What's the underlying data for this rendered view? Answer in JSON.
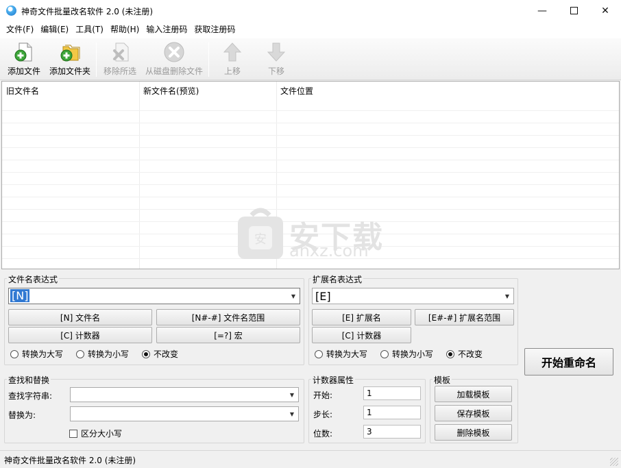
{
  "window": {
    "title": "神奇文件批量改名软件 2.0 (未注册)"
  },
  "menu": [
    "文件(F)",
    "编辑(E)",
    "工具(T)",
    "帮助(H)",
    "输入注册码",
    "获取注册码"
  ],
  "toolbar": {
    "add_file": "添加文件",
    "add_folder": "添加文件夹",
    "remove_selected": "移除所选",
    "delete_from_disk": "从磁盘删除文件",
    "move_up": "上移",
    "move_down": "下移"
  },
  "file_list": {
    "columns": [
      "旧文件名",
      "新文件名(预览)",
      "文件位置"
    ],
    "rows": []
  },
  "watermark": {
    "text": "安下载",
    "sub": "anxz.com"
  },
  "filename_expr": {
    "label": "文件名表达式",
    "value": "[N]",
    "buttons": [
      "[N] 文件名",
      "[N#-#] 文件名范围",
      "[C] 计数器",
      "[=?] 宏"
    ],
    "radios": [
      "转换为大写",
      "转换为小写",
      "不改变"
    ],
    "selected_radio": 2
  },
  "ext_expr": {
    "label": "扩展名表达式",
    "value": "[E]",
    "buttons": [
      "[E] 扩展名",
      "[E#-#] 扩展名范围",
      "[C] 计数器"
    ],
    "radios": [
      "转换为大写",
      "转换为小写",
      "不改变"
    ],
    "selected_radio": 2
  },
  "find_replace": {
    "label": "查找和替换",
    "find_label": "查找字符串:",
    "find_value": "",
    "replace_label": "替换为:",
    "replace_value": "",
    "case_label": "区分大小写",
    "case_checked": false
  },
  "counter": {
    "label": "计数器属性",
    "start_label": "开始:",
    "start_value": "1",
    "step_label": "步长:",
    "step_value": "1",
    "digits_label": "位数:",
    "digits_value": "3"
  },
  "template": {
    "label": "模板",
    "load": "加载模板",
    "save": "保存模板",
    "delete": "删除模板"
  },
  "start_button": "开始重命名",
  "status": {
    "text": "神奇文件批量改名软件 2.0 (未注册)"
  }
}
